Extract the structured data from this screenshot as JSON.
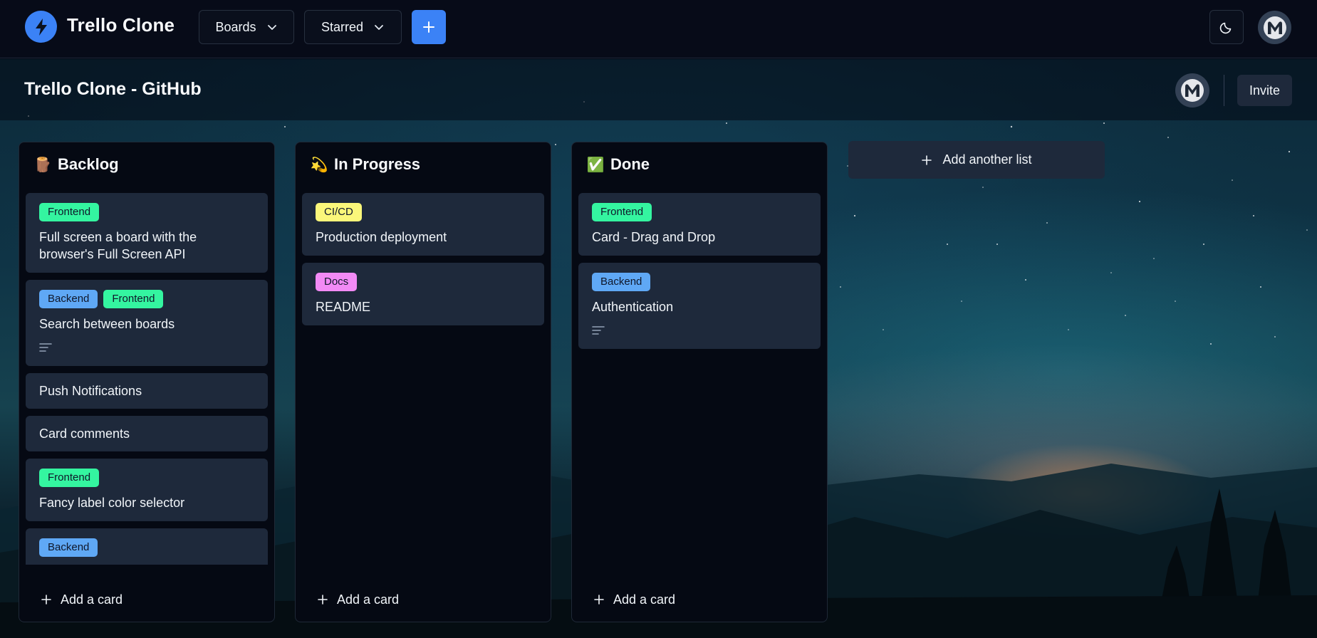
{
  "app": {
    "title": "Trello Clone"
  },
  "nav": {
    "boards_label": "Boards",
    "starred_label": "Starred"
  },
  "board": {
    "title": "Trello Clone - GitHub",
    "invite_label": "Invite"
  },
  "colors": {
    "accent": "#3b82f6",
    "label_frontend": "#34f5a0",
    "label_backend": "#5fa8f5",
    "label_cicd": "#fbf77a",
    "label_docs": "#f28af5"
  },
  "lists": [
    {
      "emoji": "🪵",
      "title": "Backlog",
      "add_card_label": "Add a card",
      "cards": [
        {
          "labels": [
            "Frontend"
          ],
          "title": "Full screen a board with the browser's Full Screen API"
        },
        {
          "labels": [
            "Backend",
            "Frontend"
          ],
          "title": "Search between boards",
          "has_description": true
        },
        {
          "labels": [],
          "title": "Push Notifications"
        },
        {
          "labels": [],
          "title": "Card comments"
        },
        {
          "labels": [
            "Frontend"
          ],
          "title": "Fancy label color selector"
        },
        {
          "labels": [
            "Backend"
          ],
          "title": ""
        }
      ]
    },
    {
      "emoji": "💫",
      "title": "In Progress",
      "add_card_label": "Add a card",
      "cards": [
        {
          "labels": [
            "CI/CD"
          ],
          "title": "Production deployment"
        },
        {
          "labels": [
            "Docs"
          ],
          "title": "README"
        }
      ]
    },
    {
      "emoji": "✅",
      "title": "Done",
      "add_card_label": "Add a card",
      "cards": [
        {
          "labels": [
            "Frontend"
          ],
          "title": "Card - Drag and Drop"
        },
        {
          "labels": [
            "Backend"
          ],
          "title": "Authentication",
          "has_description": true
        }
      ]
    }
  ],
  "add_list_label": "Add another list",
  "icons": {
    "logo": "lightning-bolt-icon",
    "dropdown": "chevron-down-icon",
    "create": "plus-icon",
    "theme": "moon-icon",
    "avatar": "monogram-m-icon",
    "description": "text-lines-icon"
  }
}
